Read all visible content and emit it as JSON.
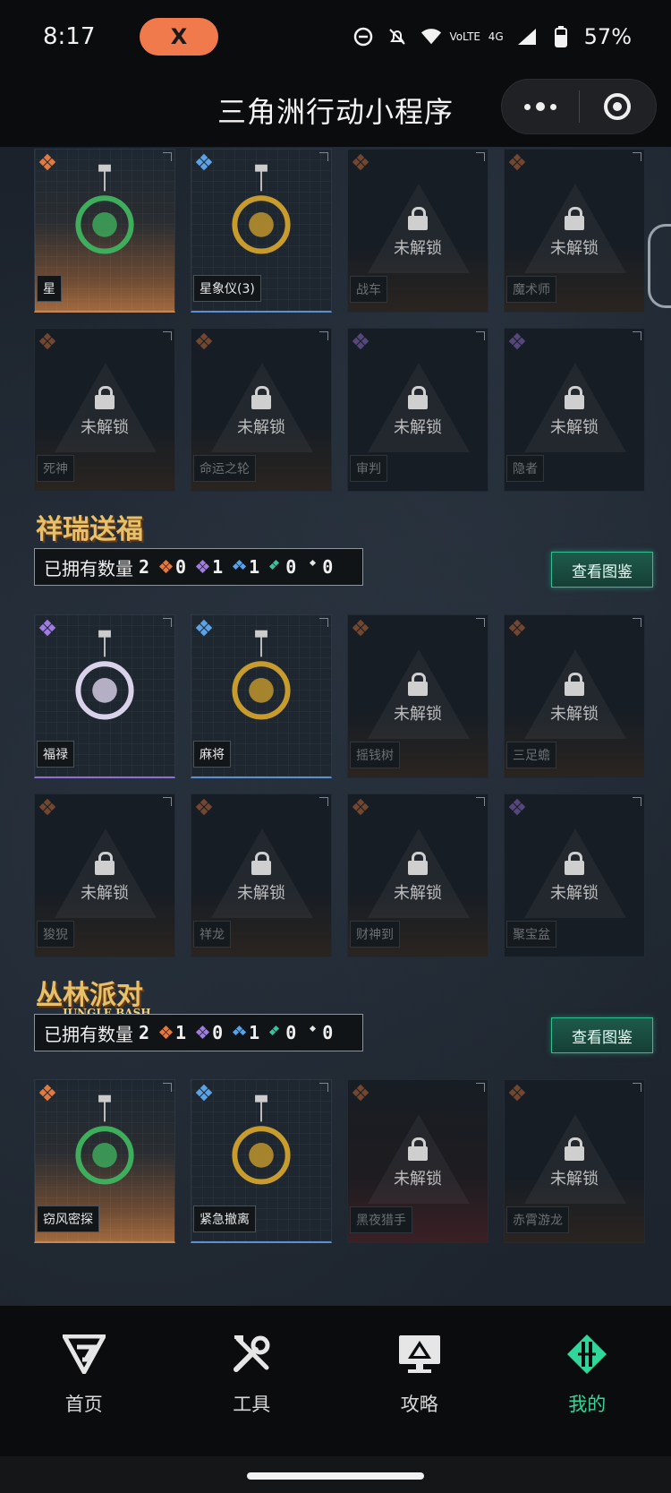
{
  "status_bar": {
    "time": "8:17",
    "pill_label": "X",
    "network": "4G",
    "battery": "57%"
  },
  "header": {
    "title": "三角洲行动小程序"
  },
  "lock_text": "未解锁",
  "section1": {
    "items": [
      {
        "name": "星",
        "rarity": "orange",
        "unlocked": true
      },
      {
        "name": "星象仪(3)",
        "rarity": "blue",
        "unlocked": true
      },
      {
        "name": "战车",
        "rarity": "orange",
        "unlocked": false
      },
      {
        "name": "魔术师",
        "rarity": "orange",
        "unlocked": false
      },
      {
        "name": "死神",
        "rarity": "orange",
        "unlocked": false
      },
      {
        "name": "命运之轮",
        "rarity": "orange",
        "unlocked": false
      },
      {
        "name": "审判",
        "rarity": "purple",
        "unlocked": false
      },
      {
        "name": "隐者",
        "rarity": "purple",
        "unlocked": false
      }
    ]
  },
  "section2": {
    "logo": "祥瑞送福",
    "owned_label": "已拥有数量",
    "owned_count": "2",
    "counts": {
      "orange": "0",
      "purple": "1",
      "blue": "1",
      "green": "0",
      "white": "0"
    },
    "view_button": "查看图鉴",
    "items": [
      {
        "name": "福禄",
        "rarity": "purple",
        "unlocked": true
      },
      {
        "name": "麻将",
        "rarity": "blue",
        "unlocked": true
      },
      {
        "name": "摇钱树",
        "rarity": "orange",
        "unlocked": false
      },
      {
        "name": "三足蟾",
        "rarity": "orange",
        "unlocked": false
      },
      {
        "name": "狻猊",
        "rarity": "orange",
        "unlocked": false
      },
      {
        "name": "祥龙",
        "rarity": "orange",
        "unlocked": false
      },
      {
        "name": "财神到",
        "rarity": "orange",
        "unlocked": false
      },
      {
        "name": "聚宝盆",
        "rarity": "purple",
        "unlocked": false
      }
    ]
  },
  "section3": {
    "logo": "丛林派对",
    "logo_sub": "JUNGLE BASH",
    "owned_label": "已拥有数量",
    "owned_count": "2",
    "counts": {
      "orange": "1",
      "purple": "0",
      "blue": "1",
      "green": "0",
      "white": "0"
    },
    "view_button": "查看图鉴",
    "items": [
      {
        "name": "窃风密探",
        "rarity": "orange",
        "unlocked": true
      },
      {
        "name": "紧急撤离",
        "rarity": "blue",
        "unlocked": true
      },
      {
        "name": "黑夜猎手",
        "rarity": "red",
        "unlocked": false
      },
      {
        "name": "赤霄游龙",
        "rarity": "orange",
        "unlocked": false
      }
    ]
  },
  "bottom_nav": [
    {
      "label": "首页",
      "icon": "home-logo-icon",
      "active": false
    },
    {
      "label": "工具",
      "icon": "tools-icon",
      "active": false
    },
    {
      "label": "攻略",
      "icon": "guide-monitor-icon",
      "active": false
    },
    {
      "label": "我的",
      "icon": "profile-logo-icon",
      "active": true
    }
  ],
  "colors": {
    "accent": "#2fd79a",
    "orange": "#e07a3e",
    "blue": "#5aa3e6",
    "purple": "#a07be6"
  }
}
